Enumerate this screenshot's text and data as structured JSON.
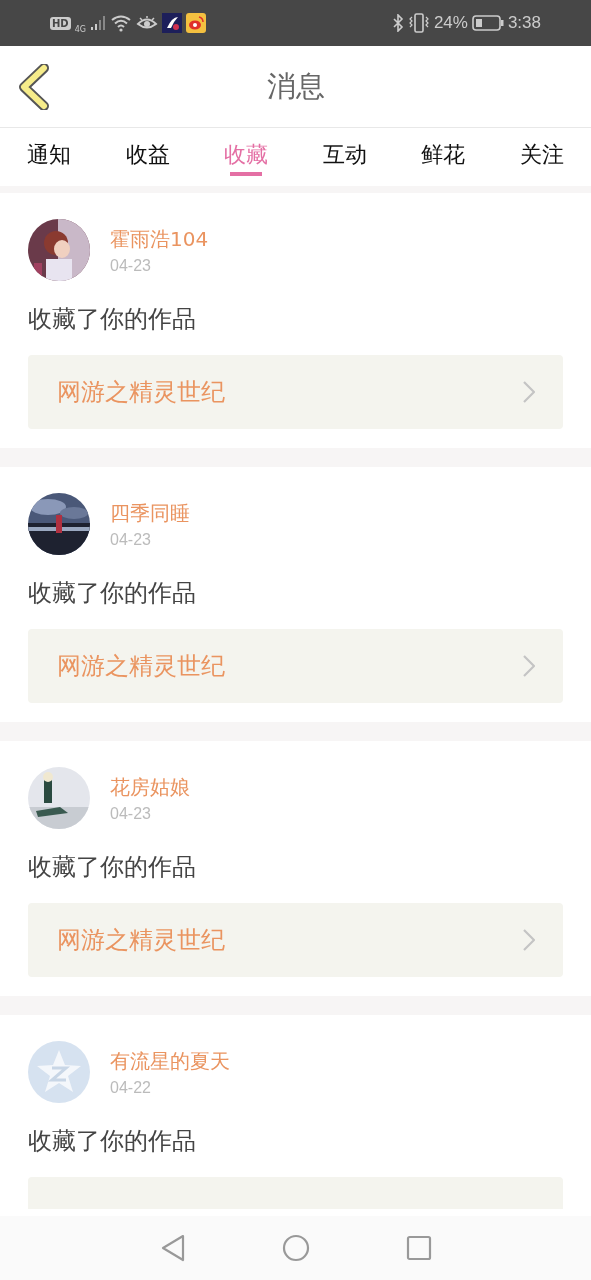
{
  "status_bar": {
    "hd": "HD",
    "network": "4G",
    "battery": "24%",
    "time": "3:38"
  },
  "header": {
    "title": "消息"
  },
  "tabs": [
    {
      "label": "通知",
      "selected": false
    },
    {
      "label": "收益",
      "selected": false
    },
    {
      "label": "收藏",
      "selected": true
    },
    {
      "label": "互动",
      "selected": false
    },
    {
      "label": "鲜花",
      "selected": false
    },
    {
      "label": "关注",
      "selected": false
    }
  ],
  "messages": [
    {
      "name": "霍雨浩104",
      "date": "04-23",
      "text": "收藏了你的作品",
      "work": "网游之精灵世纪"
    },
    {
      "name": "四季同睡",
      "date": "04-23",
      "text": "收藏了你的作品",
      "work": "网游之精灵世纪"
    },
    {
      "name": "花房姑娘",
      "date": "04-23",
      "text": "收藏了你的作品",
      "work": "网游之精灵世纪"
    },
    {
      "avatar": {
        "kind": "default"
      },
      "name": "有流星的夏天",
      "date": "04-22",
      "text": "收藏了你的作品"
    }
  ]
}
